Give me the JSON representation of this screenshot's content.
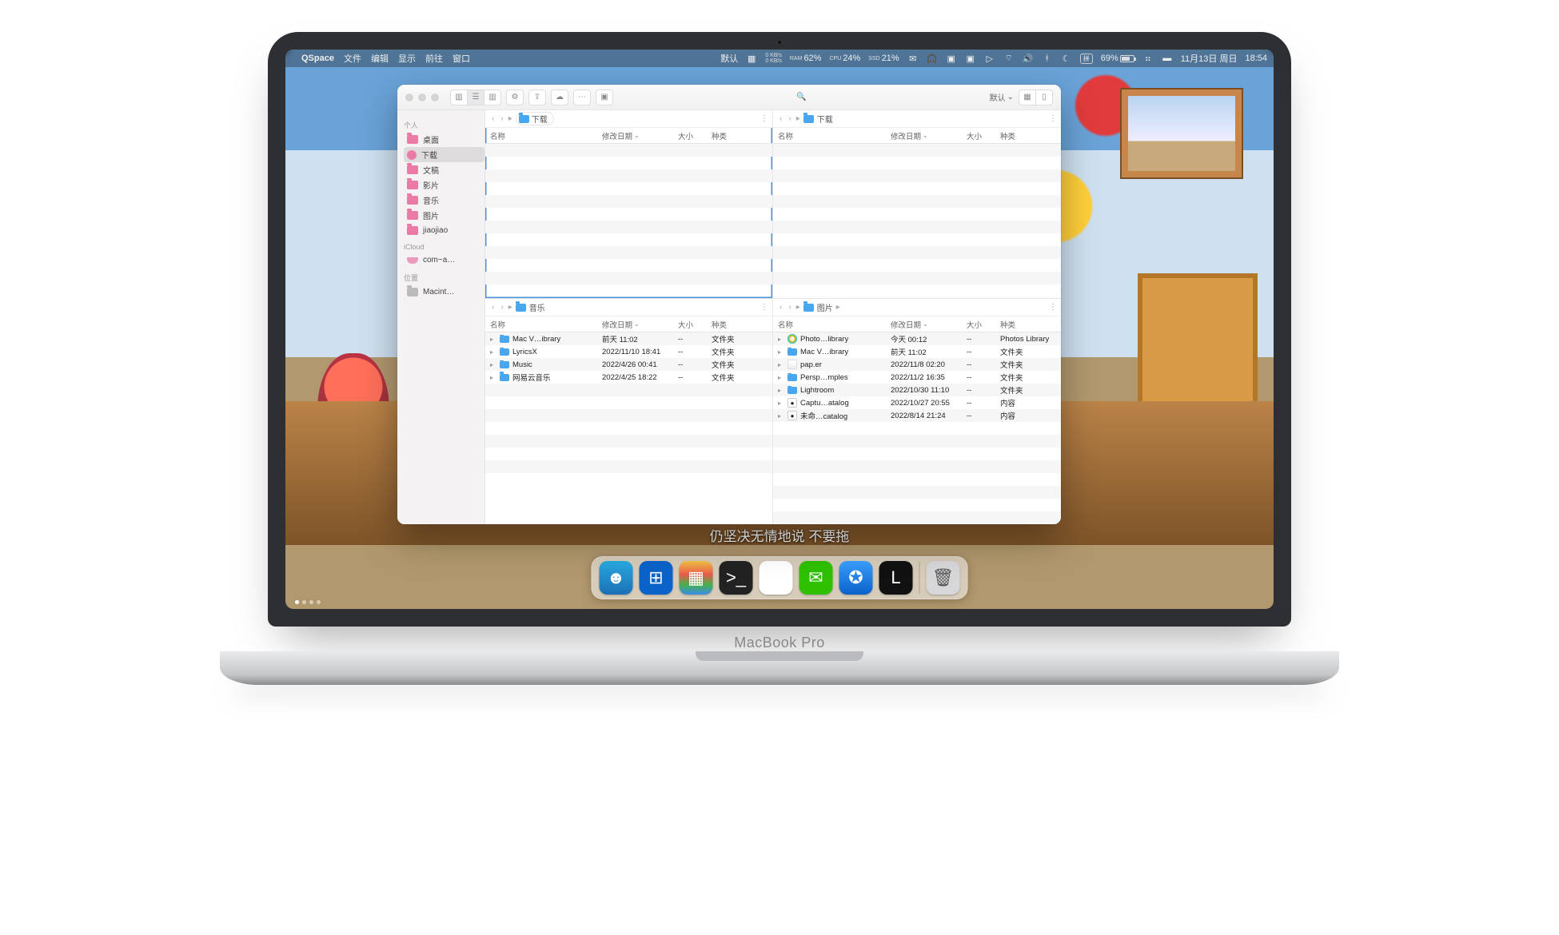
{
  "menubar": {
    "app": "QSpace",
    "items": [
      "文件",
      "编辑",
      "显示",
      "前往",
      "窗口"
    ],
    "lang_default": "默认",
    "net": {
      "up": "0 KB/s",
      "down": "0 KB/s"
    },
    "ram": {
      "label": "RAM",
      "value": "62%"
    },
    "cpu": {
      "label": "CPU",
      "value": "24%"
    },
    "ssd": {
      "label": "SSD",
      "value": "21%"
    },
    "input": "拼",
    "battery": "69%",
    "date": "11月13日 周日",
    "time": "18:54"
  },
  "caption": "仍坚决无情地说 不要拖",
  "brand": "MacBook Pro",
  "toolbar": {
    "viewmode": "默认"
  },
  "sidebar": {
    "sections": [
      {
        "title": "个人",
        "items": [
          {
            "icon": "folder",
            "label": "桌面"
          },
          {
            "icon": "circle",
            "label": "下载",
            "selected": true
          },
          {
            "icon": "folder",
            "label": "文稿"
          },
          {
            "icon": "folder",
            "label": "影片"
          },
          {
            "icon": "folder",
            "label": "音乐"
          },
          {
            "icon": "folder",
            "label": "图片"
          },
          {
            "icon": "home",
            "label": "jiaojiao"
          }
        ]
      },
      {
        "title": "iCloud",
        "items": [
          {
            "icon": "cloud",
            "label": "com~a…"
          }
        ]
      },
      {
        "title": "位置",
        "items": [
          {
            "icon": "disk",
            "label": "Macint…"
          }
        ]
      }
    ]
  },
  "columns": {
    "name": "名称",
    "date": "修改日期",
    "size": "大小",
    "kind": "种类"
  },
  "panes": {
    "tl": {
      "active": true,
      "path": "下载",
      "files": []
    },
    "tr": {
      "active": false,
      "path": "下载",
      "files": []
    },
    "bl": {
      "active": false,
      "path": "音乐",
      "files": [
        {
          "icon": "folder",
          "name": "Mac V…ibrary",
          "date": "前天 11:02",
          "size": "--",
          "kind": "文件夹"
        },
        {
          "icon": "folder",
          "name": "LyricsX",
          "date": "2022/11/10 18:41",
          "size": "--",
          "kind": "文件夹"
        },
        {
          "icon": "folder",
          "name": "Music",
          "date": "2022/4/26 00:41",
          "size": "--",
          "kind": "文件夹"
        },
        {
          "icon": "folder",
          "name": "网易云音乐",
          "date": "2022/4/25 18:22",
          "size": "--",
          "kind": "文件夹"
        }
      ]
    },
    "br": {
      "active": false,
      "path": "图片",
      "extracrumb": true,
      "files": [
        {
          "icon": "photos",
          "name": "Photo…library",
          "date": "今天 00:12",
          "size": "--",
          "kind": "Photos Library"
        },
        {
          "icon": "folder",
          "name": "Mac V…ibrary",
          "date": "前天 11:02",
          "size": "--",
          "kind": "文件夹"
        },
        {
          "icon": "app",
          "name": "pap.er",
          "date": "2022/11/8 02:20",
          "size": "--",
          "kind": "文件夹"
        },
        {
          "icon": "folder",
          "name": "Persp…mples",
          "date": "2022/11/2 16:35",
          "size": "--",
          "kind": "文件夹"
        },
        {
          "icon": "folder",
          "name": "Lightroom",
          "date": "2022/10/30 11:10",
          "size": "--",
          "kind": "文件夹"
        },
        {
          "icon": "doc",
          "name": "Captu…atalog",
          "date": "2022/10/27 20:55",
          "size": "--",
          "kind": "内容"
        },
        {
          "icon": "doc",
          "name": "未命…catalog",
          "date": "2022/8/14 21:24",
          "size": "--",
          "kind": "内容"
        }
      ]
    }
  },
  "dock": {
    "apps": [
      {
        "name": "finder",
        "bg": "linear-gradient(#29abe2,#1b6fb5)",
        "glyph": "☻"
      },
      {
        "name": "windows",
        "bg": "#0a63c9",
        "glyph": "⊞"
      },
      {
        "name": "launchpad",
        "bg": "linear-gradient(#f6c445,#ea5a4b 40%,#48b04b 70%,#3a8ee6)",
        "glyph": "▦"
      },
      {
        "name": "terminal",
        "bg": "#222",
        "glyph": ">_"
      },
      {
        "name": "chrome",
        "bg": "#fff",
        "glyph": "◉"
      },
      {
        "name": "wechat",
        "bg": "#2dc100",
        "glyph": "✉"
      },
      {
        "name": "safari",
        "bg": "linear-gradient(#3aa0ff,#0a61c9)",
        "glyph": "✪"
      },
      {
        "name": "logseq",
        "bg": "#111",
        "glyph": "L"
      }
    ],
    "trash": {
      "name": "trash",
      "bg": "#d7d7d9",
      "glyph": "🗑"
    }
  }
}
